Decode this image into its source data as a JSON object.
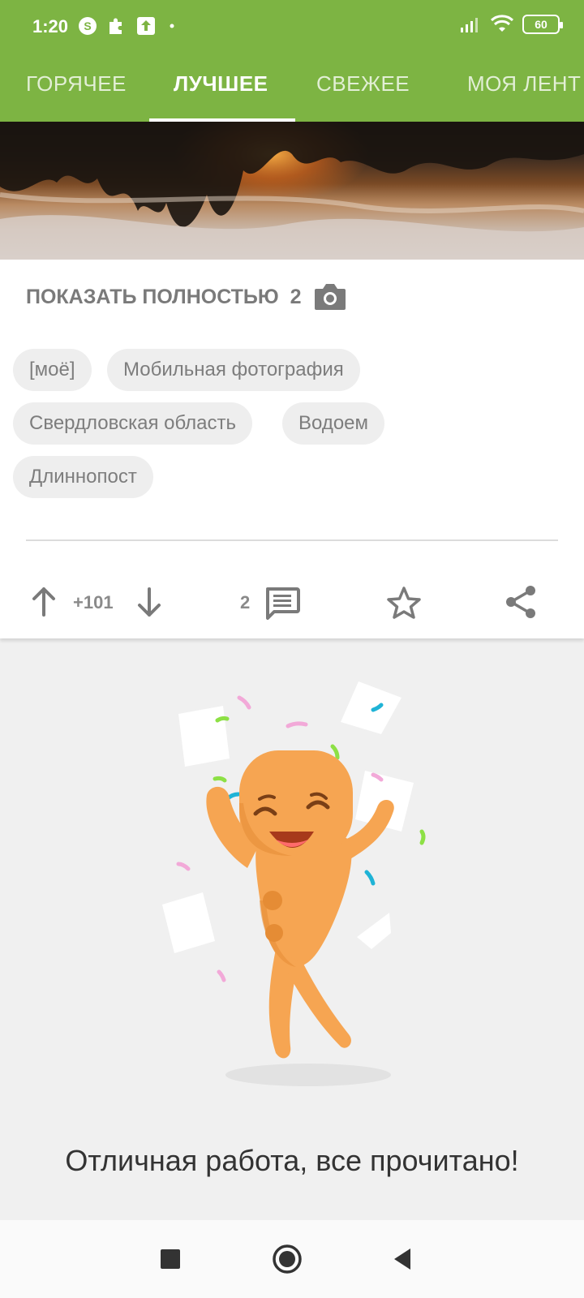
{
  "status_bar": {
    "time": "1:20",
    "battery": "60",
    "icons": [
      "skype-icon",
      "puzzle-icon",
      "upload-icon",
      "dot-icon",
      "signal-icon",
      "wifi-icon",
      "battery-icon"
    ]
  },
  "tabs": [
    {
      "label": "ГОРЯЧЕЕ",
      "active": false
    },
    {
      "label": "ЛУЧШЕЕ",
      "active": true
    },
    {
      "label": "СВЕЖЕЕ",
      "active": false
    },
    {
      "label": "МОЯ ЛЕНТ",
      "active": false
    }
  ],
  "post": {
    "show_full_label": "ПОКАЗАТЬ ПОЛНОСТЬЮ",
    "image_count": "2",
    "tags": [
      "[моё]",
      "Мобильная фотография",
      "Свердловская область",
      "Водоем",
      "Длиннопост"
    ],
    "rating": "+101",
    "comments_count": "2"
  },
  "empty_state": {
    "message": "Отличная работа, все прочитано!"
  },
  "colors": {
    "header_green": "#7db443",
    "gingerbread": "#f6a552",
    "text_gray": "#7a7a7a"
  }
}
